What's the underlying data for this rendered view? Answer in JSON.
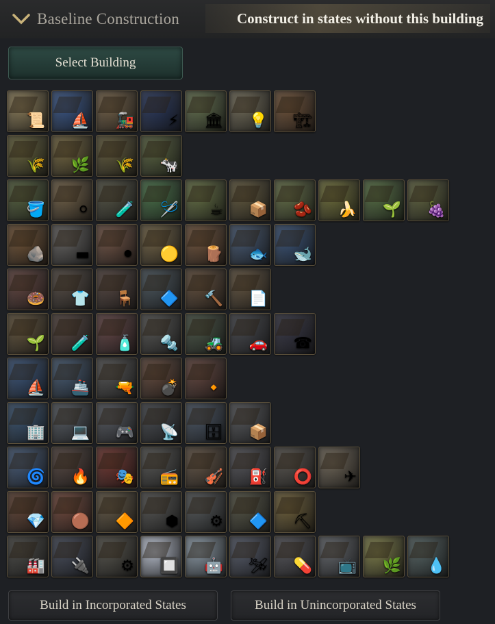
{
  "header": {
    "title": "Baseline Construction",
    "subtitle": "Construct in states without this building",
    "collapse_icon": "chevron-down-icon"
  },
  "select_button_label": "Select Building",
  "footer": {
    "incorporated_label": "Build in Incorporated States",
    "unincorporated_label": "Build in Unincorporated States"
  },
  "building_rows": [
    {
      "tiles": [
        {
          "name": "government-administration",
          "color": "#8a7a52",
          "glyph": "📜"
        },
        {
          "name": "port",
          "color": "#2f4f86",
          "glyph": "⛵"
        },
        {
          "name": "railway",
          "color": "#6e5a3e",
          "glyph": "🚂"
        },
        {
          "name": "power-plant",
          "color": "#1d2d56",
          "glyph": "⚡"
        },
        {
          "name": "university",
          "color": "#5c6a45",
          "glyph": "🏛"
        },
        {
          "name": "electric-lighting",
          "color": "#6b6550",
          "glyph": "💡"
        },
        {
          "name": "construction-sector",
          "color": "#6a4a2e",
          "glyph": "🏗"
        }
      ]
    },
    {
      "tiles": [
        {
          "name": "wheat-farm",
          "color": "#5e5a30",
          "glyph": "🌾"
        },
        {
          "name": "rice-farm",
          "color": "#6d5f35",
          "glyph": "🌿"
        },
        {
          "name": "rye-farm",
          "color": "#5a5230",
          "glyph": "🌾"
        },
        {
          "name": "livestock-ranch",
          "color": "#4f5a34",
          "glyph": "🐄"
        }
      ]
    },
    {
      "tiles": [
        {
          "name": "maize-farm",
          "color": "#4d5a34",
          "glyph": "🪣"
        },
        {
          "name": "cotton-plantation",
          "color": "#6c5a3e",
          "glyph": "⚪"
        },
        {
          "name": "dye-plantation",
          "color": "#4a4a3a",
          "glyph": "🧪"
        },
        {
          "name": "silk-plantation",
          "color": "#3e6a3e",
          "glyph": "🪡"
        },
        {
          "name": "tea-plantation",
          "color": "#5e6a3a",
          "glyph": "☕"
        },
        {
          "name": "tobacco-plantation",
          "color": "#5a5032",
          "glyph": "📦"
        },
        {
          "name": "coffee-plantation",
          "color": "#5e6a3e",
          "glyph": "🫘"
        },
        {
          "name": "banana-plantation",
          "color": "#6a6a30",
          "glyph": "🍌"
        },
        {
          "name": "opium-plantation",
          "color": "#4e6a3a",
          "glyph": "🌱"
        },
        {
          "name": "vineyard",
          "color": "#5a5e36",
          "glyph": "🍇"
        }
      ]
    },
    {
      "tiles": [
        {
          "name": "coal-mine",
          "color": "#6a4a2a",
          "glyph": "🪨"
        },
        {
          "name": "iron-mine",
          "color": "#5c5a58",
          "glyph": "▬"
        },
        {
          "name": "lead-mine",
          "color": "#6a4a3a",
          "glyph": "⚫"
        },
        {
          "name": "sulfur-mine",
          "color": "#6a5a3a",
          "glyph": "🟡"
        },
        {
          "name": "logging-camp",
          "color": "#6a4a30",
          "glyph": "🪵"
        },
        {
          "name": "fishing-wharf",
          "color": "#3a4e6a",
          "glyph": "🐟"
        },
        {
          "name": "whaling-station",
          "color": "#2e4a72",
          "glyph": "🐋"
        }
      ]
    },
    {
      "tiles": [
        {
          "name": "food-industry",
          "color": "#5a3a34",
          "glyph": "🍩"
        },
        {
          "name": "textile-mill",
          "color": "#4a4038",
          "glyph": "👕"
        },
        {
          "name": "furniture-manufactory",
          "color": "#4a3a34",
          "glyph": "🪑"
        },
        {
          "name": "glassworks",
          "color": "#3e4a52",
          "glyph": "🔷"
        },
        {
          "name": "tooling-workshop",
          "color": "#5a4430",
          "glyph": "🔨"
        },
        {
          "name": "paper-mill",
          "color": "#5a4a34",
          "glyph": "📄"
        }
      ]
    },
    {
      "tiles": [
        {
          "name": "chemical-plant",
          "color": "#5a4a30",
          "glyph": "🌱"
        },
        {
          "name": "synthetics-plant",
          "color": "#4a3a34",
          "glyph": "🧪"
        },
        {
          "name": "explosives-factory",
          "color": "#5a3a3a",
          "glyph": "🧴"
        },
        {
          "name": "steel-mill",
          "color": "#4a4a48",
          "glyph": "🔩"
        },
        {
          "name": "motor-industry",
          "color": "#3e4a3a",
          "glyph": "🚜"
        },
        {
          "name": "automobile-factory",
          "color": "#3a3c42",
          "glyph": "🚗"
        },
        {
          "name": "electrics-industry",
          "color": "#2a2a3a",
          "glyph": "☎"
        }
      ]
    },
    {
      "tiles": [
        {
          "name": "shipyard",
          "color": "#2e4a72",
          "glyph": "⛵"
        },
        {
          "name": "military-shipyard",
          "color": "#3a506a",
          "glyph": "🚢"
        },
        {
          "name": "arms-industry",
          "color": "#4a4a4a",
          "glyph": "🔫"
        },
        {
          "name": "artillery-foundry",
          "color": "#5a3e30",
          "glyph": "💣"
        },
        {
          "name": "munition-plant",
          "color": "#5a3a32",
          "glyph": "🔸"
        }
      ]
    },
    {
      "tiles": [
        {
          "name": "financial-district",
          "color": "#2e4a6a",
          "glyph": "🏢"
        },
        {
          "name": "software-company",
          "color": "#4a5058",
          "glyph": "💻"
        },
        {
          "name": "entertainment-studio",
          "color": "#4a4e56",
          "glyph": "🎮"
        },
        {
          "name": "telecommunications",
          "color": "#3a3e44",
          "glyph": "📡"
        },
        {
          "name": "data-center",
          "color": "#3e4a5a",
          "glyph": "🗄"
        },
        {
          "name": "logistics-hub",
          "color": "#4a4c50",
          "glyph": "📦"
        }
      ]
    },
    {
      "tiles": [
        {
          "name": "wind-farm",
          "color": "#3a5070",
          "glyph": "🌀"
        },
        {
          "name": "oil-refinery",
          "color": "#4a3a34",
          "glyph": "🔥"
        },
        {
          "name": "arts-academy",
          "color": "#6a2a24",
          "glyph": "🎭"
        },
        {
          "name": "radio-station",
          "color": "#4a4a48",
          "glyph": "📻"
        },
        {
          "name": "concert-hall",
          "color": "#5a4a3a",
          "glyph": "🎻"
        },
        {
          "name": "fuel-depot",
          "color": "#4a4a50",
          "glyph": "⛽"
        },
        {
          "name": "rubber-plant",
          "color": "#4e4a44",
          "glyph": "⭕"
        },
        {
          "name": "airport",
          "color": "#6a6050",
          "glyph": "✈"
        }
      ]
    },
    {
      "tiles": [
        {
          "name": "gem-mine",
          "color": "#5a3a2a",
          "glyph": "💎"
        },
        {
          "name": "copper-mine",
          "color": "#6a3e30",
          "glyph": "🟤"
        },
        {
          "name": "bauxite-mine",
          "color": "#5a4e3a",
          "glyph": "🔶"
        },
        {
          "name": "rare-earth-mine",
          "color": "#4a4a48",
          "glyph": "⬢"
        },
        {
          "name": "uranium-mine",
          "color": "#4a4e50",
          "glyph": "⚙"
        },
        {
          "name": "gas-extraction",
          "color": "#4a4a3a",
          "glyph": "🔷"
        },
        {
          "name": "open-pit-mine",
          "color": "#6a5a30",
          "glyph": "⛏"
        }
      ]
    },
    {
      "tiles": [
        {
          "name": "heavy-industry",
          "color": "#3e3e3a",
          "glyph": "🏭"
        },
        {
          "name": "electronics-factory",
          "color": "#3a4050",
          "glyph": "🔌"
        },
        {
          "name": "machinery-plant",
          "color": "#4a4840",
          "glyph": "⚙"
        },
        {
          "name": "semiconductor-fab",
          "color": "#c0c8d8",
          "glyph": "🔲"
        },
        {
          "name": "robotics-factory",
          "color": "#8a9aa8",
          "glyph": "🤖"
        },
        {
          "name": "aerospace-industry",
          "color": "#4a5060",
          "glyph": "🛩"
        },
        {
          "name": "pharmaceutical-plant",
          "color": "#4a4a50",
          "glyph": "💊"
        },
        {
          "name": "appliance-factory",
          "color": "#5a5e64",
          "glyph": "📺"
        },
        {
          "name": "agro-industry",
          "color": "#7a7a40",
          "glyph": "🌿"
        },
        {
          "name": "water-treatment",
          "color": "#4a5a5a",
          "glyph": "💧"
        }
      ]
    }
  ]
}
